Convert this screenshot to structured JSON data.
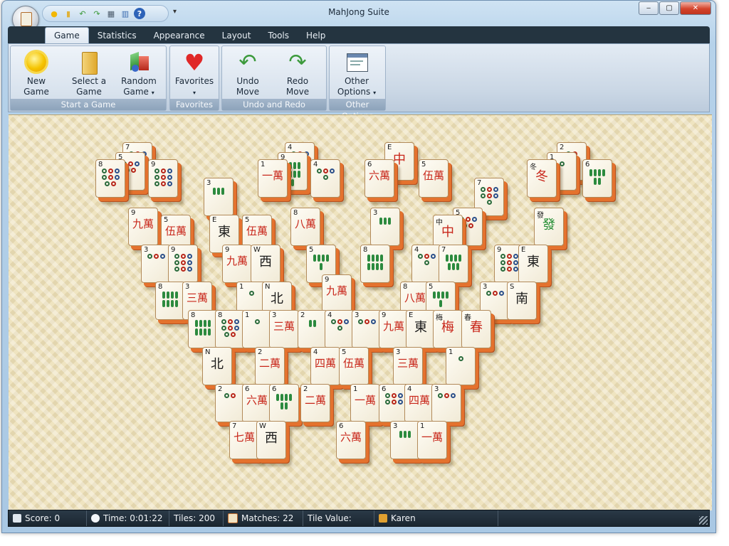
{
  "window": {
    "title": "MahJong Suite",
    "controls": {
      "minimize": "‒",
      "maximize": "▢",
      "close": "✕"
    }
  },
  "quick_access": {
    "icons": [
      "sun-icon",
      "folder-icon",
      "undo-icon",
      "redo-icon",
      "grid-icon",
      "chart-icon",
      "help-icon"
    ],
    "more_glyph": "▾"
  },
  "ribbon": {
    "tabs": [
      {
        "label": "Game",
        "active": true
      },
      {
        "label": "Statistics",
        "active": false
      },
      {
        "label": "Appearance",
        "active": false
      },
      {
        "label": "Layout",
        "active": false
      },
      {
        "label": "Tools",
        "active": false
      },
      {
        "label": "Help",
        "active": false
      }
    ],
    "groups": {
      "start": {
        "caption": "Start a Game",
        "new_game": {
          "line1": "New",
          "line2": "Game"
        },
        "select_game": {
          "line1": "Select a",
          "line2": "Game"
        },
        "random_game": {
          "line1": "Random",
          "line2": "Game",
          "caret": "▾"
        }
      },
      "favorites": {
        "caption": "Favorites",
        "favorites": {
          "line1": "Favorites",
          "caret": "▾"
        }
      },
      "undo_redo": {
        "caption": "Undo and Redo",
        "undo": {
          "line1": "Undo",
          "line2": "Move"
        },
        "redo": {
          "line1": "Redo",
          "line2": "Move"
        }
      },
      "other": {
        "caption": "Other Options",
        "other_options": {
          "line1": "Other",
          "line2": "Options",
          "caret": "▾"
        }
      }
    }
  },
  "board": {
    "tiles": [
      {
        "n": "7",
        "t": "dots",
        "c": 5
      },
      {
        "n": "8",
        "t": "dots",
        "c": 8
      },
      {
        "n": "5",
        "t": "dots",
        "c": 5
      },
      {
        "n": "9",
        "t": "dots",
        "c": 9
      },
      {
        "n": "4",
        "t": "dots",
        "c": 4
      },
      {
        "n": "1",
        "t": "char",
        "g": "一萬",
        "col": "red"
      },
      {
        "n": "9",
        "t": "bam",
        "c": 9
      },
      {
        "n": "4",
        "t": "dots",
        "c": 4
      },
      {
        "n": "E",
        "t": "char",
        "g": "中",
        "col": "red"
      },
      {
        "n": "6",
        "t": "char",
        "g": "六萬",
        "col": "red"
      },
      {
        "n": "5",
        "t": "char",
        "g": "伍萬",
        "col": "red"
      },
      {
        "n": "2",
        "t": "dots",
        "c": 2
      },
      {
        "n": "1",
        "t": "dots",
        "c": 1
      },
      {
        "n": "冬",
        "t": "char",
        "g": "冬",
        "col": "red"
      },
      {
        "n": "6",
        "t": "bam",
        "c": 6
      },
      {
        "n": "3",
        "t": "bam",
        "c": 3
      },
      {
        "n": "7",
        "t": "dots",
        "c": 7
      },
      {
        "n": "9",
        "t": "char",
        "g": "九萬",
        "col": "red"
      },
      {
        "n": "5",
        "t": "char",
        "g": "伍萬",
        "col": "red"
      },
      {
        "n": "E",
        "t": "char",
        "g": "東",
        "col": "blk"
      },
      {
        "n": "5",
        "t": "char",
        "g": "伍萬",
        "col": "red"
      },
      {
        "n": "8",
        "t": "char",
        "g": "八萬",
        "col": "red"
      },
      {
        "n": "3",
        "t": "bam",
        "c": 3
      },
      {
        "n": "中",
        "t": "char",
        "g": "中",
        "col": "red"
      },
      {
        "n": "5",
        "t": "dots",
        "c": 5
      },
      {
        "n": "發",
        "t": "char",
        "g": "發",
        "col": "grn"
      },
      {
        "n": "3",
        "t": "dots",
        "c": 3
      },
      {
        "n": "9",
        "t": "dots",
        "c": 9
      },
      {
        "n": "9",
        "t": "char",
        "g": "九萬",
        "col": "red"
      },
      {
        "n": "W",
        "t": "char",
        "g": "西",
        "col": "blk"
      },
      {
        "n": "5",
        "t": "bam",
        "c": 5
      },
      {
        "n": "8",
        "t": "bam",
        "c": 8
      },
      {
        "n": "4",
        "t": "dots",
        "c": 4
      },
      {
        "n": "7",
        "t": "bam",
        "c": 7
      },
      {
        "n": "9",
        "t": "dots",
        "c": 9
      },
      {
        "n": "E",
        "t": "char",
        "g": "東",
        "col": "blk"
      },
      {
        "n": "8",
        "t": "bam",
        "c": 8
      },
      {
        "n": "3",
        "t": "char",
        "g": "三萬",
        "col": "red"
      },
      {
        "n": "1",
        "t": "dots",
        "c": 1
      },
      {
        "n": "N",
        "t": "char",
        "g": "北",
        "col": "blk"
      },
      {
        "n": "9",
        "t": "char",
        "g": "九萬",
        "col": "red"
      },
      {
        "n": "8",
        "t": "char",
        "g": "八萬",
        "col": "red"
      },
      {
        "n": "5",
        "t": "bam",
        "c": 5
      },
      {
        "n": "3",
        "t": "dots",
        "c": 3
      },
      {
        "n": "S",
        "t": "char",
        "g": "南",
        "col": "blk"
      },
      {
        "n": "8",
        "t": "bam",
        "c": 8
      },
      {
        "n": "8",
        "t": "dots",
        "c": 8
      },
      {
        "n": "1",
        "t": "dots",
        "c": 1
      },
      {
        "n": "3",
        "t": "char",
        "g": "三萬",
        "col": "red"
      },
      {
        "n": "2",
        "t": "bam",
        "c": 2
      },
      {
        "n": "4",
        "t": "dots",
        "c": 4
      },
      {
        "n": "3",
        "t": "dots",
        "c": 3
      },
      {
        "n": "9",
        "t": "char",
        "g": "九萬",
        "col": "red"
      },
      {
        "n": "E",
        "t": "char",
        "g": "東",
        "col": "blk"
      },
      {
        "n": "梅",
        "t": "char",
        "g": "梅",
        "col": "red"
      },
      {
        "n": "春",
        "t": "char",
        "g": "春",
        "col": "red"
      },
      {
        "n": "N",
        "t": "char",
        "g": "北",
        "col": "blk"
      },
      {
        "n": "2",
        "t": "char",
        "g": "二萬",
        "col": "red"
      },
      {
        "n": "4",
        "t": "char",
        "g": "四萬",
        "col": "red"
      },
      {
        "n": "5",
        "t": "char",
        "g": "伍萬",
        "col": "red"
      },
      {
        "n": "3",
        "t": "char",
        "g": "三萬",
        "col": "red"
      },
      {
        "n": "1",
        "t": "dots",
        "c": 1
      },
      {
        "n": "2",
        "t": "dots",
        "c": 2
      },
      {
        "n": "6",
        "t": "char",
        "g": "六萬",
        "col": "red"
      },
      {
        "n": "6",
        "t": "bam",
        "c": 6
      },
      {
        "n": "2",
        "t": "char",
        "g": "二萬",
        "col": "red"
      },
      {
        "n": "1",
        "t": "char",
        "g": "一萬",
        "col": "red"
      },
      {
        "n": "6",
        "t": "dots",
        "c": 6
      },
      {
        "n": "4",
        "t": "char",
        "g": "四萬",
        "col": "red"
      },
      {
        "n": "3",
        "t": "dots",
        "c": 3
      },
      {
        "n": "7",
        "t": "char",
        "g": "七萬",
        "col": "red"
      },
      {
        "n": "W",
        "t": "char",
        "g": "西",
        "col": "blk"
      },
      {
        "n": "6",
        "t": "char",
        "g": "六萬",
        "col": "red"
      },
      {
        "n": "3",
        "t": "bam",
        "c": 3
      },
      {
        "n": "1",
        "t": "char",
        "g": "一萬",
        "col": "red"
      }
    ]
  },
  "status_bar": {
    "score": "Score: 0",
    "time": "Time: 0:01:22",
    "tiles": "Tiles: 200",
    "matches": "Matches: 22",
    "tile_value": "Tile Value:",
    "player": "Karen"
  },
  "colors": {
    "accent": "#e4722e",
    "ribbon_dark": "#243440",
    "board": "#efe4c0"
  }
}
